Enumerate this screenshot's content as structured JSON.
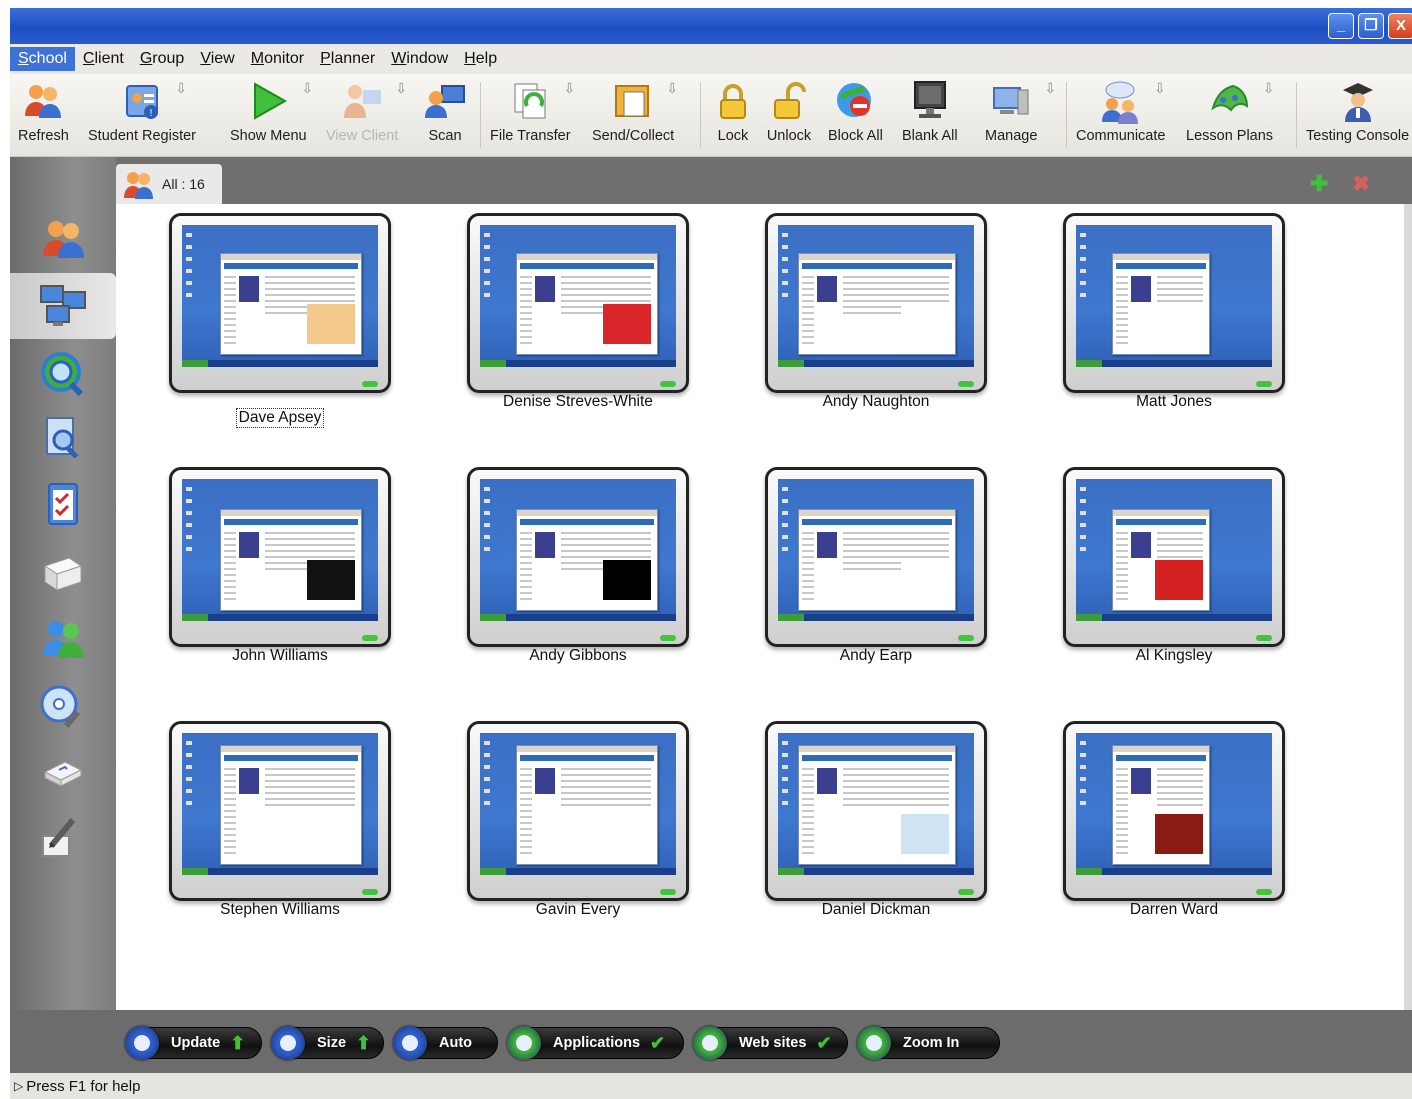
{
  "window": {
    "controls": {
      "minimize": "_",
      "restore": "❐",
      "close": "X"
    }
  },
  "menubar": {
    "items": [
      {
        "accel": "S",
        "rest": "chool"
      },
      {
        "accel": "C",
        "rest": "lient"
      },
      {
        "accel": "G",
        "rest": "roup"
      },
      {
        "accel": "V",
        "rest": "iew"
      },
      {
        "accel": "M",
        "rest": "onitor"
      },
      {
        "accel": "P",
        "rest": "lanner"
      },
      {
        "accel": "W",
        "rest": "indow"
      },
      {
        "accel": "H",
        "rest": "elp"
      }
    ]
  },
  "toolbar": {
    "items": [
      {
        "label": "Refresh",
        "icon": "refresh-users-icon"
      },
      {
        "label": "Student Register",
        "icon": "register-icon"
      },
      {
        "label": "Show Menu",
        "icon": "play-icon"
      },
      {
        "label": "View Client",
        "icon": "view-client-icon"
      },
      {
        "label": "Scan",
        "icon": "scan-icon"
      },
      {
        "label": "File Transfer",
        "icon": "file-transfer-icon"
      },
      {
        "label": "Send/Collect",
        "icon": "send-collect-icon"
      },
      {
        "label": "Lock",
        "icon": "lock-icon"
      },
      {
        "label": "Unlock",
        "icon": "unlock-icon"
      },
      {
        "label": "Block All",
        "icon": "block-all-icon"
      },
      {
        "label": "Blank All",
        "icon": "blank-all-icon"
      },
      {
        "label": "Manage",
        "icon": "manage-icon"
      },
      {
        "label": "Communicate",
        "icon": "communicate-icon"
      },
      {
        "label": "Lesson Plans",
        "icon": "lesson-plans-icon"
      },
      {
        "label": "Testing Console",
        "icon": "testing-console-icon"
      }
    ],
    "dropdown_glyph": "⇩"
  },
  "group_tab": {
    "label": "All : 16"
  },
  "strip_actions": {
    "add": "✚",
    "remove": "✖"
  },
  "students": [
    {
      "name": "Dave Apsey",
      "ad_color": "#f2c98a"
    },
    {
      "name": "Denise Streves-White",
      "ad_color": "#d9262a"
    },
    {
      "name": "Andy Naughton",
      "ad_color": "#ffffff"
    },
    {
      "name": "Matt Jones",
      "ad_color": "#ffffff"
    },
    {
      "name": "John Williams",
      "ad_color": "#111111"
    },
    {
      "name": "Andy Gibbons",
      "ad_color": "#000000"
    },
    {
      "name": "Andy Earp",
      "ad_color": "#ffffff"
    },
    {
      "name": "Al Kingsley",
      "ad_color": "#d32020"
    },
    {
      "name": "Stephen  Williams",
      "ad_color": "#ffffff"
    },
    {
      "name": "Gavin Every",
      "ad_color": "#ffffff"
    },
    {
      "name": "Daniel Dickman",
      "ad_color": "#cfe3f5"
    },
    {
      "name": "Darren Ward",
      "ad_color": "#8a1a12"
    }
  ],
  "bottombar": {
    "buttons": [
      {
        "label": "Update",
        "suffix": "⬆",
        "suffix_color": "#3fc23a",
        "icon_color": "#2f5fcf"
      },
      {
        "label": "Size",
        "suffix": "⬆",
        "suffix_color": "#3fc23a",
        "icon_color": "#2f5fcf"
      },
      {
        "label": "Auto",
        "suffix": "",
        "suffix_color": "#3fc23a",
        "icon_color": "#2f5fcf"
      },
      {
        "label": "Applications",
        "suffix": "✔",
        "suffix_color": "#3fc23a",
        "icon_color": "#3fae3a"
      },
      {
        "label": "Web sites",
        "suffix": "✔",
        "suffix_color": "#3fc23a",
        "icon_color": "#3fae3a"
      },
      {
        "label": "Zoom In",
        "suffix": "",
        "suffix_color": "#3fc23a",
        "icon_color": "#3fae3a"
      }
    ]
  },
  "statusbar": {
    "text": "Press F1 for help",
    "glyph": "▷"
  }
}
